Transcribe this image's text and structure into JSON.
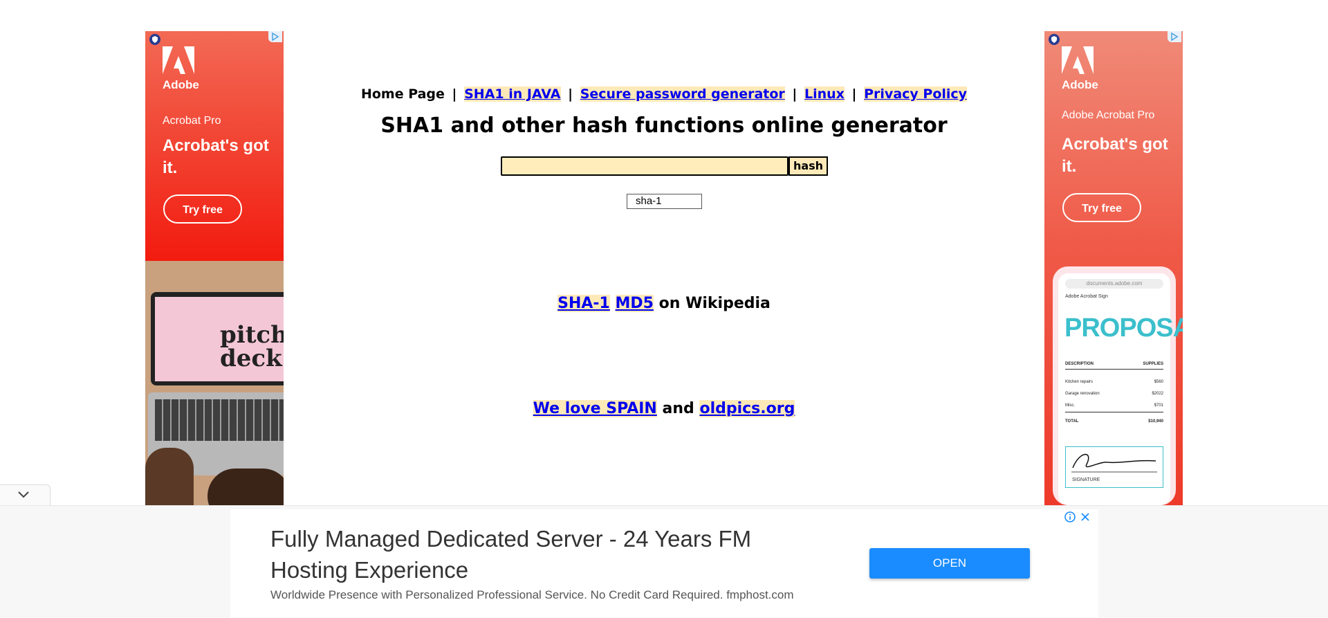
{
  "nav": {
    "home": "Home Page",
    "sep": "|",
    "links": [
      "SHA1 in JAVA",
      "Secure password generator",
      "Linux",
      "Privacy Policy"
    ]
  },
  "title": "SHA1 and other hash functions online generator",
  "hash_form": {
    "input_value": "",
    "button_label": "hash",
    "algorithm_selected": "sha-1"
  },
  "wiki": {
    "link1": "SHA-1",
    "link2": "MD5",
    "suffix": "on Wikipedia"
  },
  "spain": {
    "link1": "We love SPAIN",
    "middle": "and",
    "link2": "oldpics.org"
  },
  "left_ad": {
    "brand": "Adobe",
    "product": "Acrobat Pro",
    "tagline": "Acrobat's got it.",
    "cta": "Try free",
    "image_text": "pitch deck",
    "colors": {
      "primary": "#f21b0f"
    }
  },
  "right_ad": {
    "brand": "Adobe",
    "product": "Adobe Acrobat Pro",
    "tagline": "Acrobat's got it.",
    "cta": "Try free",
    "phone": {
      "url": "documents.adobe.com",
      "app": "Adobe Acrobat Sign",
      "heading": "PROPOSAL",
      "columns": [
        "DESCRIPTION",
        "SUPPLIES"
      ],
      "rows": [
        {
          "label": "Kitchen repairs",
          "value": "$560"
        },
        {
          "label": "Garage renovation",
          "value": "$2022"
        },
        {
          "label": "Misc.",
          "value": "$701"
        }
      ],
      "total": {
        "label": "TOTAL",
        "value": "$10,940"
      },
      "signature_label": "SIGNATURE"
    }
  },
  "bottom_ad": {
    "title": "Fully Managed Dedicated Server - 24 Years FM Hosting Experience",
    "description": "Worldwide Presence with Personalized Professional Service. No Credit Card Required. fmphost.com",
    "button": "OPEN",
    "colors": {
      "button": "#1a8cff"
    }
  }
}
